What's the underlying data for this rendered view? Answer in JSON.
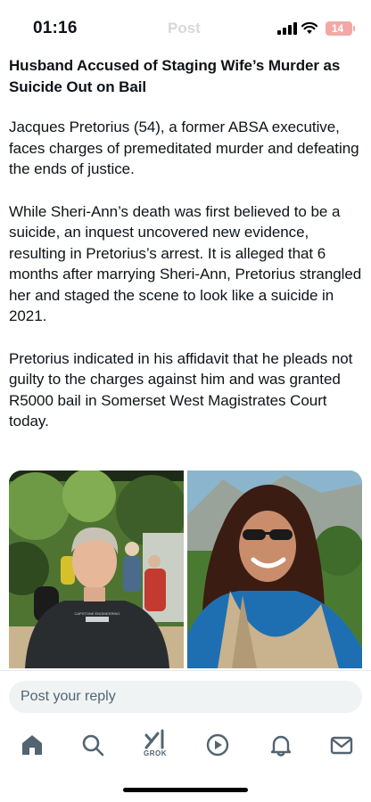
{
  "status_bar": {
    "time": "01:16",
    "ghost_text": "Post",
    "battery_level": "14",
    "icons": [
      "signal-icon",
      "wifi-icon",
      "battery-icon"
    ]
  },
  "article": {
    "headline": "Husband Accused of Staging Wife’s Murder as Suicide Out on Bail",
    "paragraphs": [
      "Jacques Pretorius (54), a former ABSA executive, faces charges of premeditated murder and defeating the ends of justice.",
      "While Sheri-Ann’s death was first believed to be a suicide, an inquest uncovered new evidence, resulting in Pretorius’s arrest. It is alleged that 6 months after marrying Sheri-Ann, Pretorius strangled her and staged the scene to look like a suicide in 2021.",
      "Pretorius indicated in his affidavit that he pleads not guilty to the charges against him and was granted R5000 bail in Somerset West Magistrates Court today."
    ]
  },
  "photos": {
    "left_shirt_text": "CAPSTONE ENGINEERING"
  },
  "reply": {
    "placeholder": "Post your reply"
  },
  "nav": {
    "grok_label": "GROK",
    "icons": [
      "home-icon",
      "search-icon",
      "grok-icon",
      "media-icon",
      "notifications-icon",
      "messages-icon"
    ]
  },
  "colors": {
    "text": "#0f1419",
    "muted": "#536471",
    "reply_bg": "#eff3f4",
    "battery_low": "#f2a9a6"
  }
}
